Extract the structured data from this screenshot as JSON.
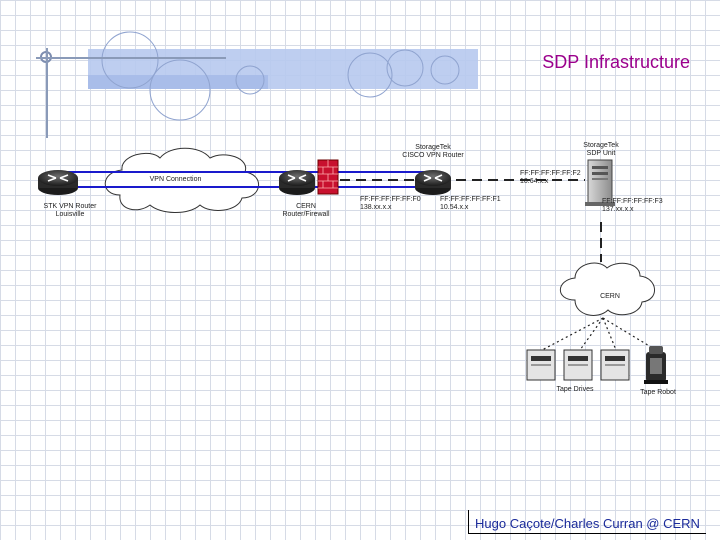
{
  "slide": {
    "title": "SDP Infrastructure",
    "footer": "Hugo Caçote/Charles Curran @ CERN"
  },
  "diagram": {
    "vpn_label": "VPN Connection",
    "stk_router": [
      "STK VPN Router",
      "Louisville"
    ],
    "cern_router": [
      "CERN",
      "Router/Firewall"
    ],
    "cisco_router": [
      "StorageTek",
      "CISCO VPN Router"
    ],
    "sdp_unit": [
      "StorageTek",
      "SDP Unit"
    ],
    "fw_addr": [
      "FF:FF:FF:FF:FF:F0",
      "138.xx.x.x"
    ],
    "cisco_addr": [
      "FF:FF:FF:FF:FF:F1",
      "10.54.x.x"
    ],
    "sdp_addr_top": [
      "FF:FF:FF:FF:FF:F2",
      "10.64.x.x"
    ],
    "sdp_addr_bottom": [
      "FF:FF:FF:FF:FF:F3",
      "137.xx.x.x"
    ],
    "cern_cloud": "CERN",
    "tape_drives": "Tape Drives",
    "tape_robot": "Tape Robot"
  },
  "colors": {
    "title": "#9b008c",
    "footer": "#1a2a9a",
    "vpn_line": "#1a1acc",
    "firewall": "#c8102e"
  }
}
